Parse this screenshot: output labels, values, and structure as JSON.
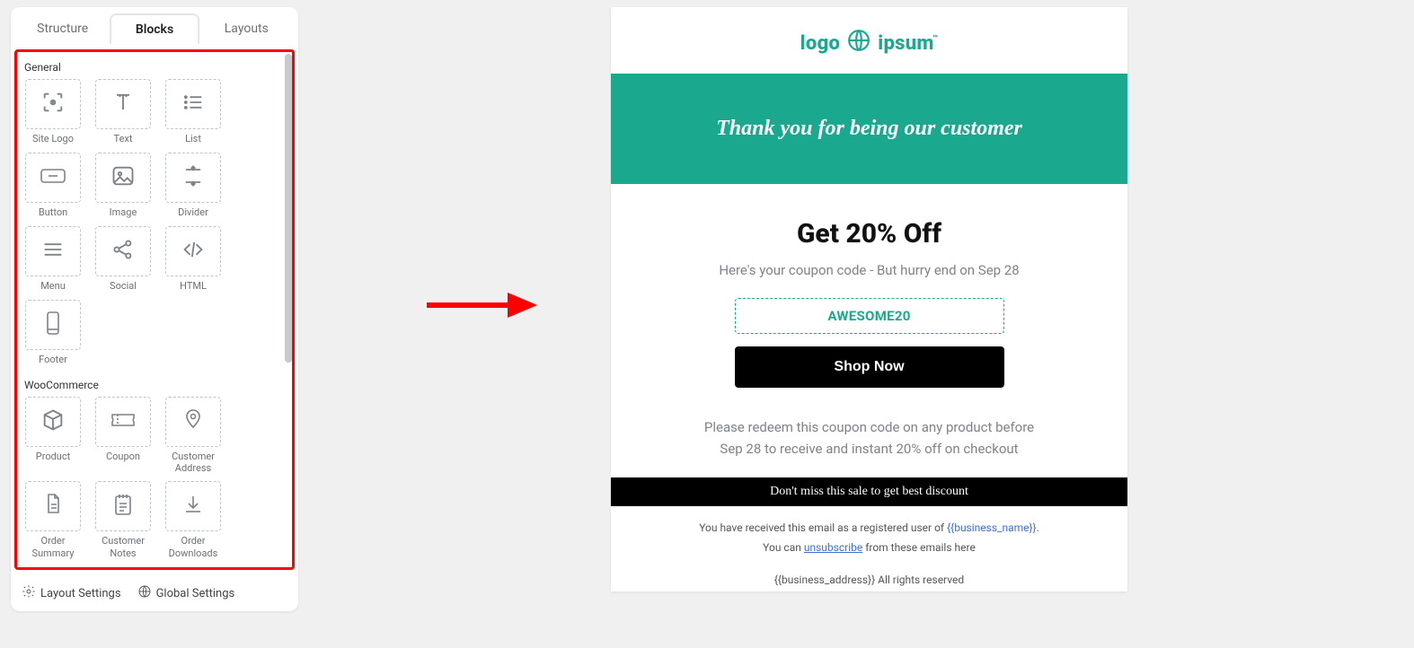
{
  "tabs": {
    "structure": "Structure",
    "blocks": "Blocks",
    "layouts": "Layouts"
  },
  "sections": {
    "general": {
      "title": "General",
      "items": [
        {
          "label": "Site Logo",
          "icon": "site-logo"
        },
        {
          "label": "Text",
          "icon": "text"
        },
        {
          "label": "List",
          "icon": "list"
        },
        {
          "label": "Button",
          "icon": "button"
        },
        {
          "label": "Image",
          "icon": "image"
        },
        {
          "label": "Divider",
          "icon": "divider"
        },
        {
          "label": "Menu",
          "icon": "menu"
        },
        {
          "label": "Social",
          "icon": "social"
        },
        {
          "label": "HTML",
          "icon": "html"
        },
        {
          "label": "Footer",
          "icon": "footer"
        }
      ]
    },
    "woo": {
      "title": "WooCommerce",
      "items": [
        {
          "label": "Product",
          "icon": "product"
        },
        {
          "label": "Coupon",
          "icon": "coupon"
        },
        {
          "label": "Customer Address",
          "icon": "address"
        },
        {
          "label": "Order Summary",
          "icon": "order-summary"
        },
        {
          "label": "Customer Notes",
          "icon": "notes"
        },
        {
          "label": "Order Downloads",
          "icon": "downloads"
        }
      ]
    }
  },
  "footer": {
    "layout": "Layout Settings",
    "global": "Global Settings"
  },
  "preview": {
    "logo_left": "logo",
    "logo_right": "ipsum",
    "banner": "Thank you for being our customer",
    "headline": "Get 20% Off",
    "subline": "Here's your coupon code - But hurry end on Sep 28",
    "coupon": "AWESOME20",
    "cta": "Shop Now",
    "redeem_line1": "Please redeem this coupon code on any product before",
    "redeem_line2": "Sep 28 to receive and instant 20% off on checkout",
    "blackbar": "Don't miss this sale to get best discount",
    "disc_prefix": "You have received this email as a registered user of ",
    "disc_business": "{{business_name}}",
    "disc_suffix": ".",
    "disc_line2_pre": "You can ",
    "disc_unsub": "unsubscribe",
    "disc_line2_post": " from these emails here",
    "addr_placeholder": "{{business_address}}",
    "addr_rights": "  All rights reserved"
  }
}
